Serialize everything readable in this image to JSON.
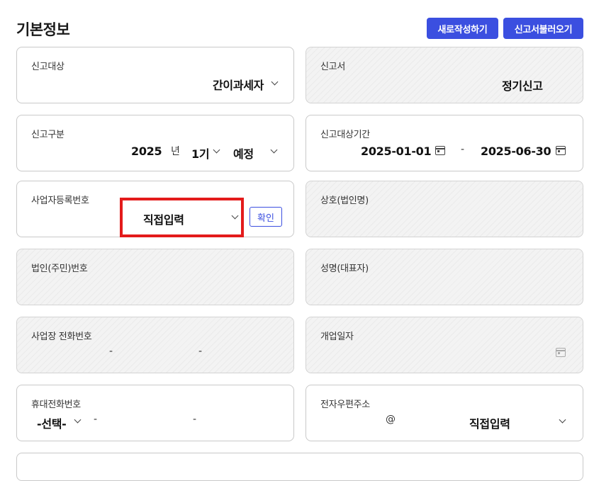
{
  "header": {
    "title": "기본정보",
    "new_button": "새로작성하기",
    "load_button": "신고서불러오기"
  },
  "fields": {
    "filing_target": {
      "label": "신고대상",
      "value": "간이과세자"
    },
    "filing_form": {
      "label": "신고서",
      "value": "정기신고"
    },
    "filing_type": {
      "label": "신고구분",
      "year": "2025",
      "year_unit": "년",
      "period": "1기",
      "kind": "예정"
    },
    "filing_period": {
      "label": "신고대상기간",
      "start": "2025-01-01",
      "sep": "-",
      "end": "2025-06-30"
    },
    "business_reg_no": {
      "label": "사업자등록번호",
      "select_value": "직접입력",
      "confirm_button": "확인"
    },
    "company_name": {
      "label": "상호(법인명)"
    },
    "corp_reg_no": {
      "label": "법인(주민)번호"
    },
    "representative": {
      "label": "성명(대표자)"
    },
    "business_phone": {
      "label": "사업장 전화번호",
      "sep": "-"
    },
    "open_date": {
      "label": "개업일자"
    },
    "mobile_phone": {
      "label": "휴대전화번호",
      "prefix": "-선택-",
      "sep": "-"
    },
    "email": {
      "label": "전자우편주소",
      "at": "@",
      "domain_select": "직접입력"
    }
  },
  "colors": {
    "accent": "#3b4fe0",
    "highlight": "#e31b1b",
    "card_border": "#c9c9c9",
    "disabled_bg": "#f3f3f3"
  }
}
